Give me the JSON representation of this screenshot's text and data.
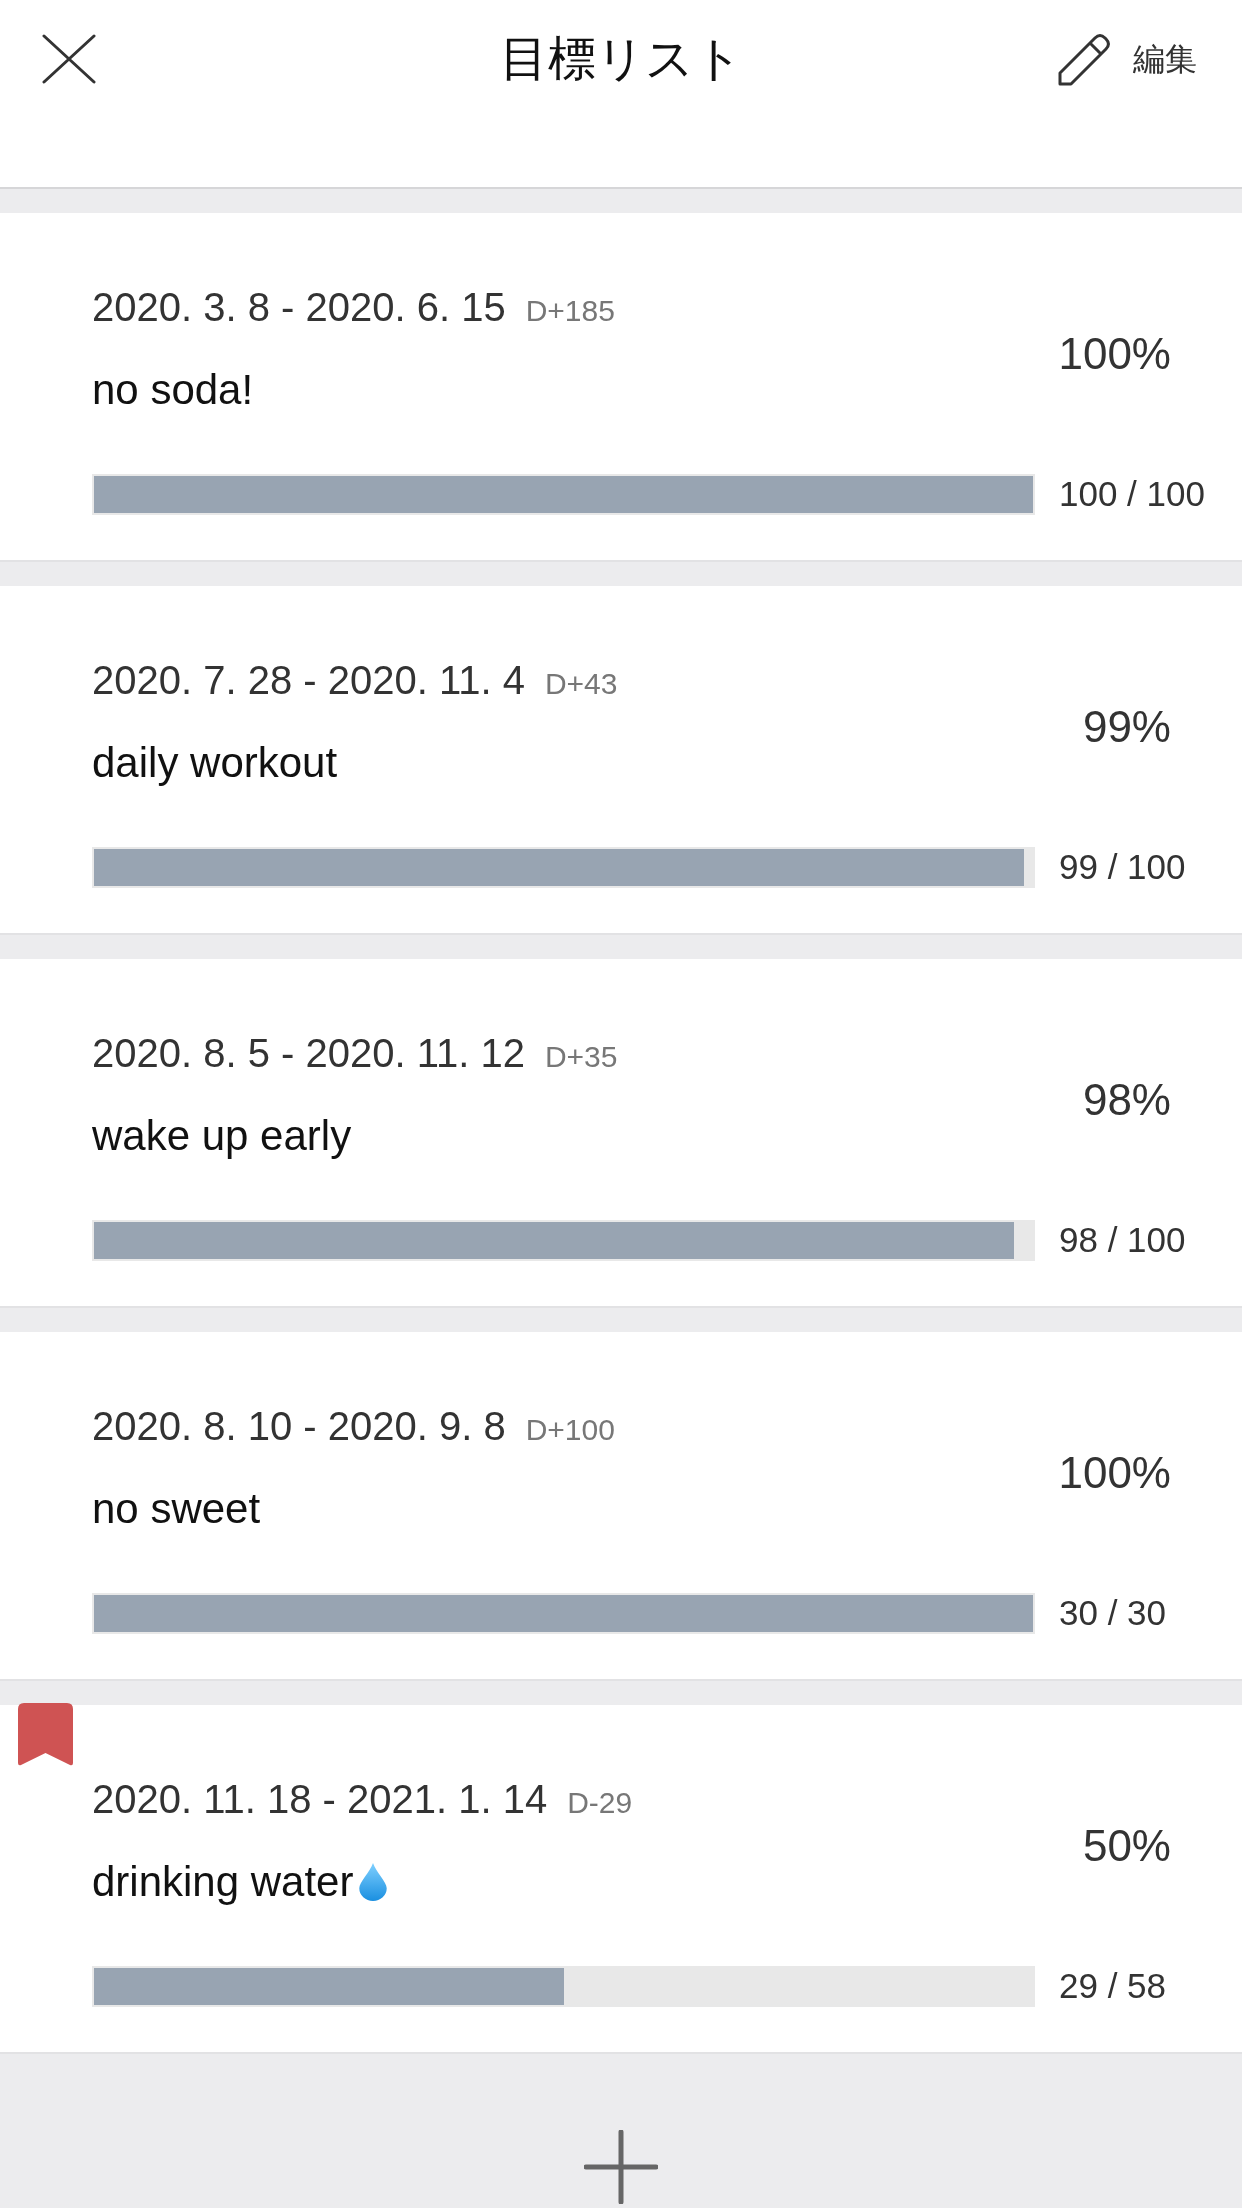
{
  "header": {
    "title": "目標リスト",
    "edit_label": "編集"
  },
  "goals": [
    {
      "period": "2020. 3. 8 - 2020. 6. 15",
      "d_day": "D+185",
      "title": "no soda!",
      "has_emoji": false,
      "bookmarked": false,
      "percent": "100%",
      "level": 1,
      "count": "100 / 100"
    },
    {
      "period": "2020. 7. 28 - 2020. 11. 4",
      "d_day": "D+43",
      "title": "daily workout",
      "has_emoji": false,
      "bookmarked": false,
      "percent": "99%",
      "level": 0.99,
      "count": "99 / 100"
    },
    {
      "period": "2020. 8. 5 - 2020. 11. 12",
      "d_day": "D+35",
      "title": "wake up early",
      "has_emoji": false,
      "bookmarked": false,
      "percent": "98%",
      "level": 0.98,
      "count": "98 / 100"
    },
    {
      "period": "2020. 8. 10 - 2020. 9. 8",
      "d_day": "D+100",
      "title": "no sweet",
      "has_emoji": false,
      "bookmarked": false,
      "percent": "100%",
      "level": 1,
      "count": "30 / 30"
    },
    {
      "period": "2020. 11. 18 - 2021. 1. 14",
      "d_day": "D-29",
      "title": "drinking water",
      "has_emoji": true,
      "bookmarked": true,
      "percent": "50%",
      "level": 0.5,
      "count": "29 / 58"
    }
  ]
}
